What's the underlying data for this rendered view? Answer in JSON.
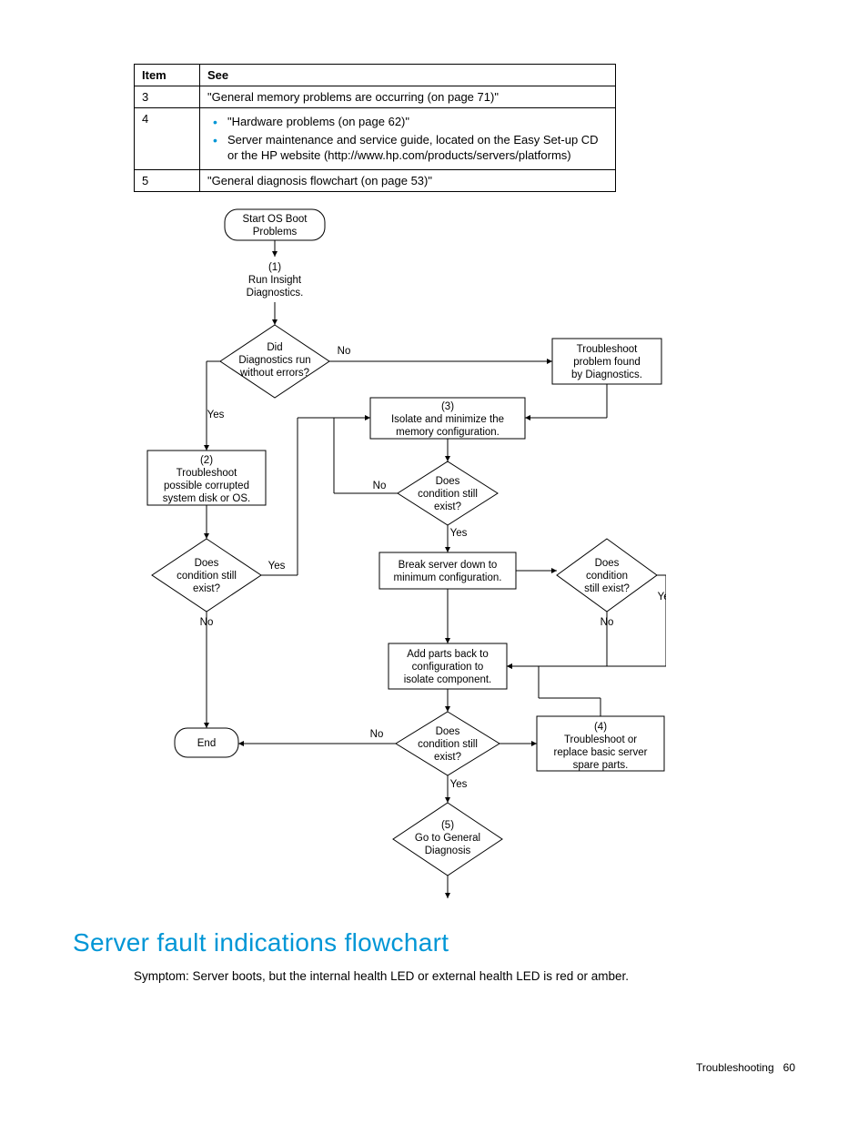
{
  "table": {
    "headers": [
      "Item",
      "See"
    ],
    "rows": [
      {
        "item": "3",
        "see_text": "\"General memory problems are occurring (on page 71)\"",
        "bullets": null
      },
      {
        "item": "4",
        "see_text": null,
        "bullets": [
          "\"Hardware problems (on page 62)\"",
          "Server maintenance and service guide, located on the Easy Set-up CD or the HP website (http://www.hp.com/products/servers/platforms)"
        ]
      },
      {
        "item": "5",
        "see_text": "\"General diagnosis flowchart (on page 53)\"",
        "bullets": null
      }
    ]
  },
  "flowchart": {
    "start": "Start OS Boot Problems",
    "n1": {
      "num": "(1)",
      "l1": "Run Insight",
      "l2": "Diagnostics."
    },
    "d_diag": {
      "l1": "Did",
      "l2": "Diagnostics run",
      "l3": "without errors?",
      "yes": "Yes",
      "no": "No"
    },
    "troubleshoot_diag": {
      "l1": "Troubleshoot",
      "l2": "problem found",
      "l3": "by Diagnostics."
    },
    "n3": {
      "num": "(3)",
      "l1": "Isolate and minimize the",
      "l2": "memory configuration."
    },
    "n2": {
      "num": "(2)",
      "l1": "Troubleshoot",
      "l2": "possible corrupted",
      "l3": "system disk or OS."
    },
    "d_cond1": {
      "l1": "Does",
      "l2": "condition still",
      "l3": "exist?",
      "yes": "Yes",
      "no": "No"
    },
    "d_cond_left": {
      "l1": "Does",
      "l2": "condition still",
      "l3": "exist?",
      "yes": "Yes",
      "no": "No"
    },
    "break_server": {
      "l1": "Break server down to",
      "l2": "minimum configuration."
    },
    "d_cond_right": {
      "l1": "Does",
      "l2": "condition",
      "l3": "still exist?",
      "yes": "Yes",
      "no": "No"
    },
    "add_parts": {
      "l1": "Add parts back to",
      "l2": "configuration to",
      "l3": "isolate component."
    },
    "d_cond2": {
      "l1": "Does",
      "l2": "condition still",
      "l3": "exist?",
      "yes": "Yes",
      "no": "No"
    },
    "n4": {
      "num": "(4)",
      "l1": "Troubleshoot or",
      "l2": "replace basic server",
      "l3": "spare parts."
    },
    "end": "End",
    "n5": {
      "num": "(5)",
      "l1": "Go to General",
      "l2": "Diagnosis"
    }
  },
  "section_heading": "Server fault indications flowchart",
  "symptom_text": "Symptom: Server boots, but the internal health LED or external health LED is red or amber.",
  "footer": {
    "label": "Troubleshooting",
    "page": "60"
  }
}
